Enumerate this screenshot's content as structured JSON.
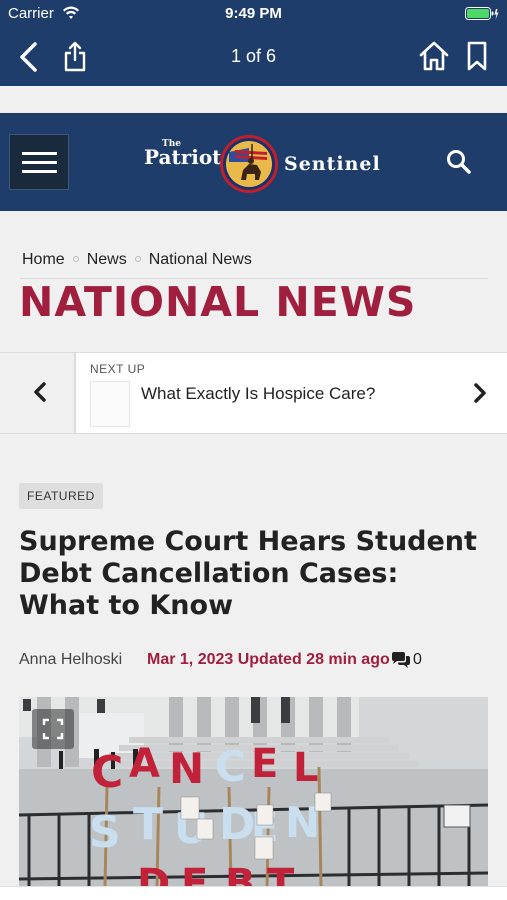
{
  "status_bar": {
    "carrier": "Carrier",
    "time": "9:49 PM"
  },
  "top_nav": {
    "pager": "1 of 6"
  },
  "site": {
    "logo_small": "The",
    "logo_left": "Patriot",
    "logo_right": "Sentinel"
  },
  "breadcrumb": [
    "Home",
    "News",
    "National News"
  ],
  "section_title": "NATIONAL NEWS",
  "next_up": {
    "label": "NEXT UP",
    "title": "What Exactly Is Hospice Care?"
  },
  "article": {
    "badge": "FEATURED",
    "headline": "Supreme Court Hears Student Debt Cancellation Cases: What to Know",
    "author": "Anna Helhoski",
    "date": "Mar 1, 2023 Updated 28 min ago",
    "comment_count": "0"
  },
  "hero_sign": {
    "line1": [
      "C",
      "A",
      "N",
      "C",
      "E",
      "L"
    ],
    "line2": [
      "S",
      "T",
      "U",
      "D",
      "E",
      "N"
    ],
    "line3": [
      "D",
      "E",
      "B",
      "T"
    ]
  },
  "colors": {
    "navy": "#1e3d6b",
    "accent": "#a11f3e",
    "background": "#f0f0f0"
  },
  "icons": [
    "back-arrow-icon",
    "share-icon",
    "home-icon",
    "bookmark-icon",
    "menu-icon",
    "search-icon",
    "chevron-left-icon",
    "chevron-right-icon",
    "comments-icon",
    "expand-icon",
    "wifi-icon",
    "battery-icon"
  ]
}
